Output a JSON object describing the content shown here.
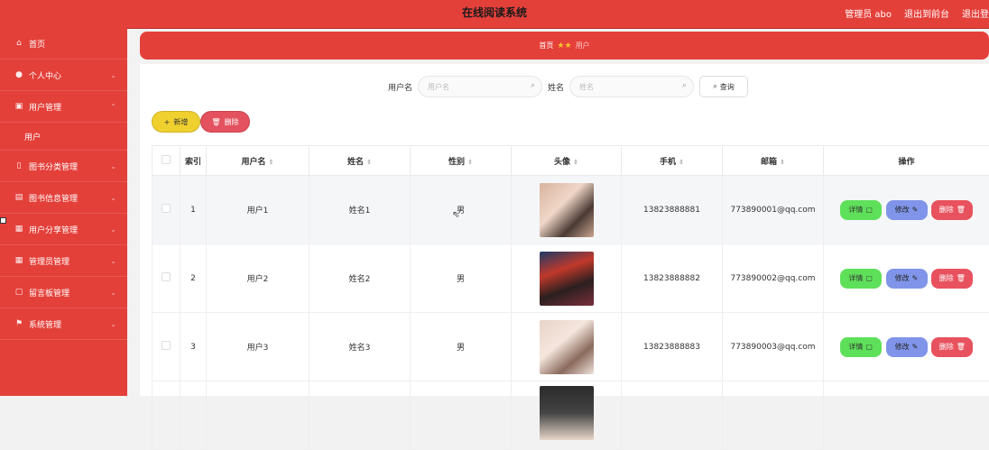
{
  "header": {
    "title": "在线阅读系统",
    "links": [
      "管理员 abo",
      "退出到前台",
      "退出登"
    ]
  },
  "sidebar": {
    "items": [
      {
        "label": "首页",
        "icon": "home-icon",
        "glyph": "⌂",
        "expandable": false
      },
      {
        "label": "个人中心",
        "icon": "user-icon",
        "glyph": "👤",
        "expandable": true
      },
      {
        "label": "用户管理",
        "icon": "users-icon",
        "glyph": "▣",
        "expandable": true
      },
      {
        "label": "图书分类管理",
        "icon": "tag-icon",
        "glyph": "▯",
        "expandable": true
      },
      {
        "label": "图书信息管理",
        "icon": "book-icon",
        "glyph": "▤",
        "expandable": true
      },
      {
        "label": "用户分享管理",
        "icon": "share-icon",
        "glyph": "▦",
        "expandable": true
      },
      {
        "label": "管理员管理",
        "icon": "admin-icon",
        "glyph": "▦",
        "expandable": true
      },
      {
        "label": "留言板管理",
        "icon": "message-icon",
        "glyph": "▢",
        "expandable": true
      },
      {
        "label": "系统管理",
        "icon": "flag-icon",
        "glyph": "⚑",
        "expandable": true
      }
    ],
    "submenu": {
      "parent_index": 2,
      "label": "用户"
    }
  },
  "breadcrumb": {
    "home": "首页",
    "current": "用户"
  },
  "search": {
    "username_label": "用户名",
    "username_placeholder": "用户名",
    "name_label": "姓名",
    "name_placeholder": "姓名",
    "query_button": "查询"
  },
  "toolbar": {
    "add_label": "新增",
    "delete_label": "删除"
  },
  "table": {
    "headers": [
      "索引",
      "用户名",
      "姓名",
      "性别",
      "头像",
      "手机",
      "邮箱",
      "操作"
    ],
    "rows": [
      {
        "index": "1",
        "username": "用户1",
        "name": "姓名1",
        "gender": "男",
        "phone": "13823888881",
        "email": "773890001@qq.com"
      },
      {
        "index": "2",
        "username": "用户2",
        "name": "姓名2",
        "gender": "男",
        "phone": "13823888882",
        "email": "773890002@qq.com"
      },
      {
        "index": "3",
        "username": "用户3",
        "name": "姓名3",
        "gender": "男",
        "phone": "13823888883",
        "email": "773890003@qq.com"
      }
    ],
    "actions": {
      "detail": "详情",
      "edit": "修改",
      "delete": "删除"
    }
  },
  "colors": {
    "primary": "#e4403a",
    "accent_yellow": "#f0d02f",
    "detail_green": "#5fe05a",
    "edit_blue": "#8095e9",
    "delete_red": "#e8525e"
  }
}
